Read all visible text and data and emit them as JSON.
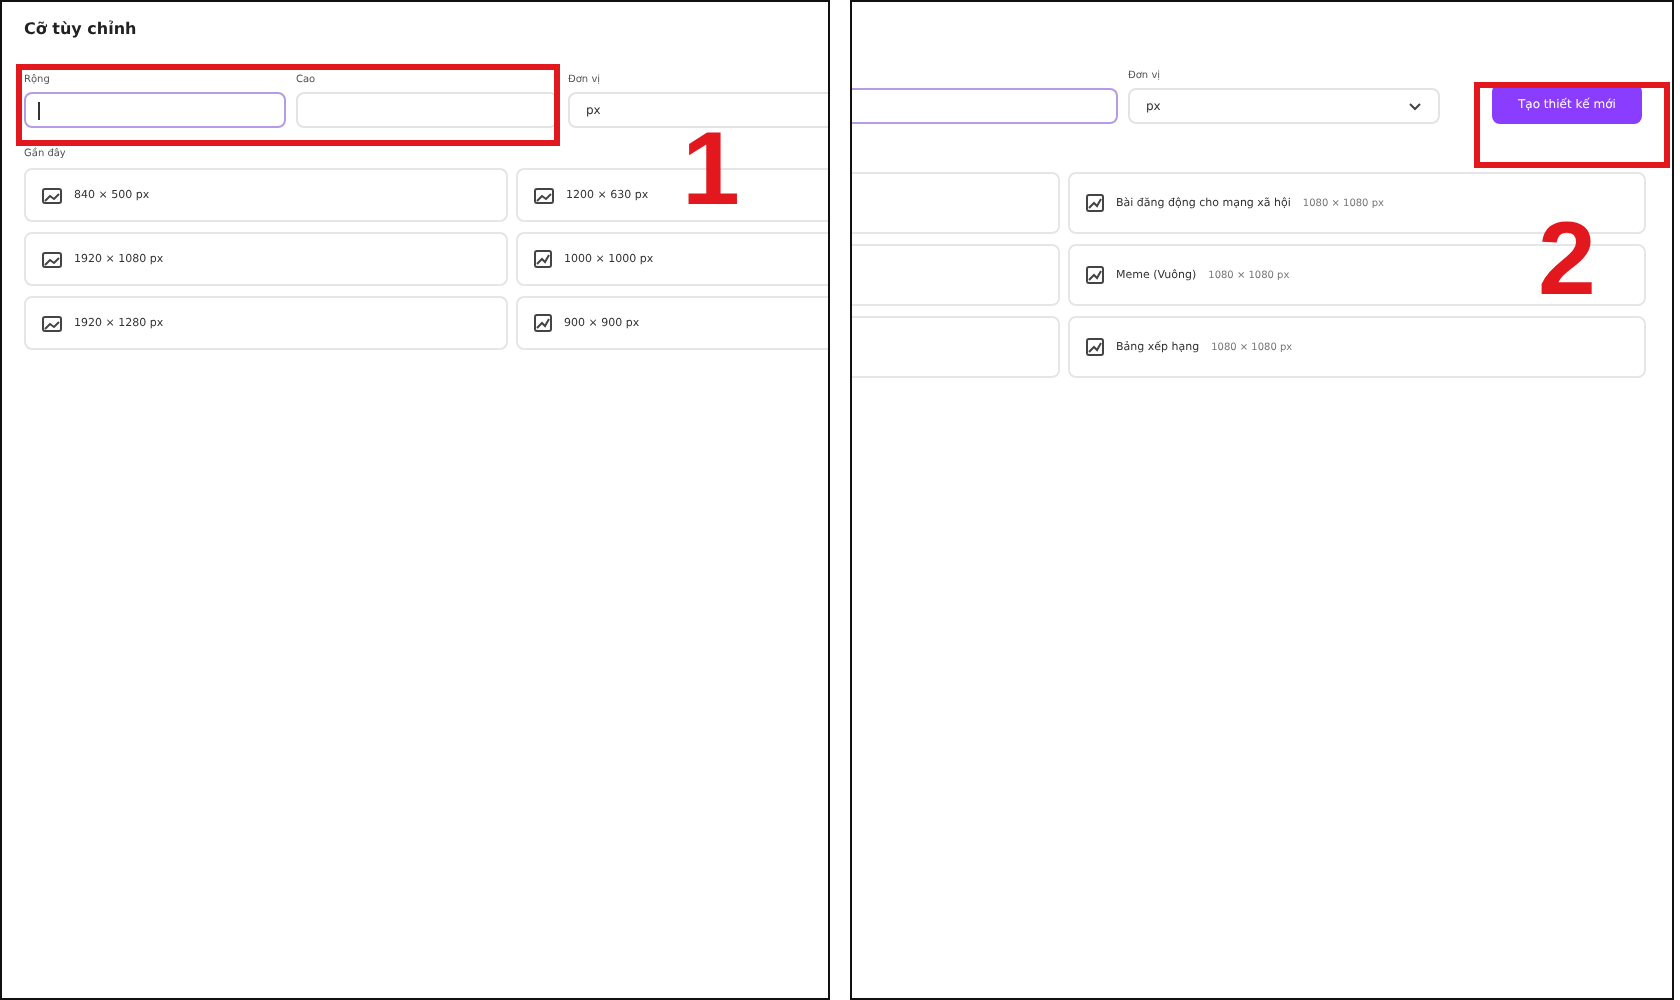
{
  "left_panel": {
    "title": "Cỡ tùy chỉnh",
    "fields": [
      {
        "label": "Rộng",
        "focused": true
      },
      {
        "label": "Cao",
        "focused": false
      }
    ],
    "unit": {
      "label": "Đơn vị",
      "value": "px"
    },
    "recent_label": "Gần đây",
    "recent": [
      {
        "size": "840 × 500 px",
        "kind": "landscape"
      },
      {
        "size": "1200 × 630 px",
        "kind": "landscape"
      },
      {
        "size": "1920 × 1080 px",
        "kind": "landscape"
      },
      {
        "size": "1000 × 1000 px",
        "kind": "square"
      },
      {
        "size": "1920 × 1280 px",
        "kind": "landscape"
      },
      {
        "size": "900 × 900 px",
        "kind": "square"
      }
    ],
    "annotation": "1"
  },
  "right_panel": {
    "unit": {
      "label": "Đơn vị",
      "value": "px"
    },
    "button": "Tạo thiết kế mới",
    "templates": [
      {
        "name": "Bài đăng động cho mạng xã hội",
        "size": "1080 × 1080 px"
      },
      {
        "name": "Meme (Vuông)",
        "size": "1080 × 1080 px"
      },
      {
        "name": "Bảng xếp hạng",
        "size": "1080 × 1080 px"
      }
    ],
    "annotation": "2"
  }
}
